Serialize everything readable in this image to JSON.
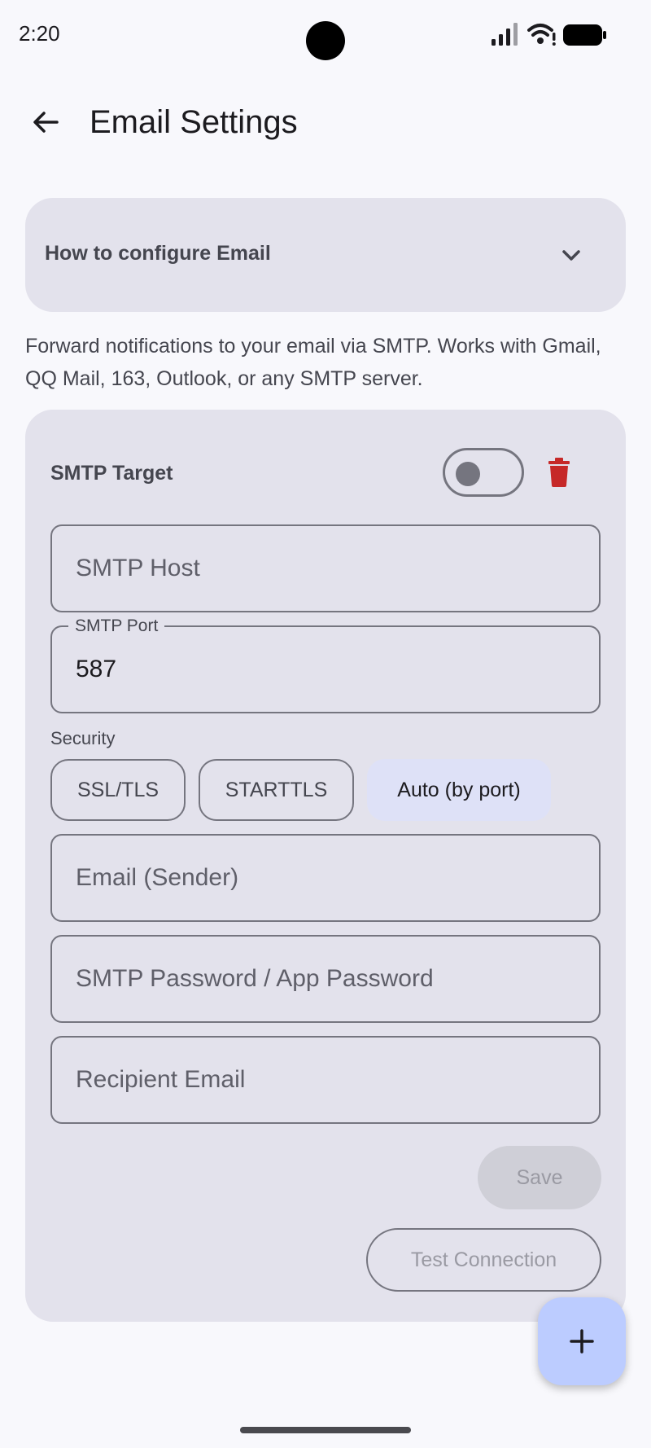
{
  "status_bar": {
    "time": "2:20"
  },
  "app_bar": {
    "title": "Email Settings"
  },
  "help": {
    "title": "How to configure Email"
  },
  "description": "Forward notifications to your email via SMTP. Works with Gmail, QQ Mail, 163, Outlook, or any SMTP server.",
  "target": {
    "title": "SMTP Target",
    "enabled": false,
    "fields": {
      "host": {
        "placeholder": "SMTP Host"
      },
      "port": {
        "label": "SMTP Port",
        "value": "587"
      },
      "sender": {
        "placeholder": "Email (Sender)"
      },
      "password": {
        "placeholder": "SMTP Password / App Password"
      },
      "recipient": {
        "placeholder": "Recipient Email"
      }
    },
    "security": {
      "label": "Security",
      "options": [
        "SSL/TLS",
        "STARTTLS",
        "Auto (by port)"
      ],
      "selected": "Auto (by port)"
    },
    "save_label": "Save",
    "test_label": "Test Connection"
  },
  "colors": {
    "accent": "#bcccff",
    "delete": "#c62828",
    "selected_chip": "#dee1f7",
    "card": "#e3e2ec"
  }
}
